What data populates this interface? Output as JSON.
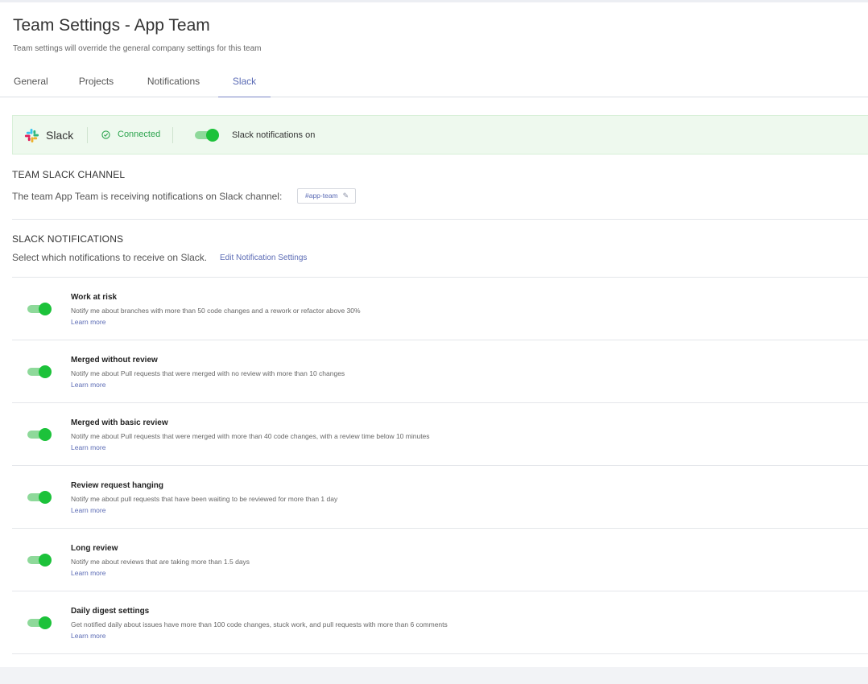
{
  "page": {
    "title": "Team Settings - App Team",
    "subtitle": "Team settings will override the general company settings for this team"
  },
  "tabs": [
    {
      "label": "General",
      "active": false
    },
    {
      "label": "Projects",
      "active": false
    },
    {
      "label": "Notifications",
      "active": false
    },
    {
      "label": "Slack",
      "active": true
    }
  ],
  "banner": {
    "app_name": "Slack",
    "status": "Connected",
    "toggle_label": "Slack notifications on",
    "toggle_on": true
  },
  "channel_section": {
    "heading": "TEAM SLACK CHANNEL",
    "text": "The team App Team is receiving notifications on Slack channel:",
    "channel": "#app-team"
  },
  "notifications_section": {
    "heading": "SLACK NOTIFICATIONS",
    "description": "Select which notifications to receive on Slack.",
    "edit_link": "Edit Notification Settings"
  },
  "notifications": [
    {
      "title": "Work at risk",
      "description": "Notify me about branches with more than 50 code changes and a rework or refactor above 30%",
      "learn_more": "Learn more",
      "enabled": true
    },
    {
      "title": "Merged without review",
      "description": "Notify me about Pull requests that were merged with no review with more than 10 changes",
      "learn_more": "Learn more",
      "enabled": true
    },
    {
      "title": "Merged with basic review",
      "description": "Notify me about Pull requests that were merged with more than 40 code changes, with a review time below 10 minutes",
      "learn_more": "Learn more",
      "enabled": true
    },
    {
      "title": "Review request hanging",
      "description": "Notify me about pull requests that have been waiting to be reviewed for more than 1 day",
      "learn_more": "Learn more",
      "enabled": true
    },
    {
      "title": "Long review",
      "description": "Notify me about reviews that are taking more than 1.5 days",
      "learn_more": "Learn more",
      "enabled": true
    },
    {
      "title": "Daily digest settings",
      "description": "Get notified daily about issues have more than 100 code changes, stuck work, and pull requests with more than 6 comments",
      "learn_more": "Learn more",
      "enabled": true
    }
  ],
  "colors": {
    "accent": "#5b6bb5",
    "toggle_on": "#1cc23a",
    "connected": "#2da44e",
    "banner_bg": "#eef9ee"
  }
}
